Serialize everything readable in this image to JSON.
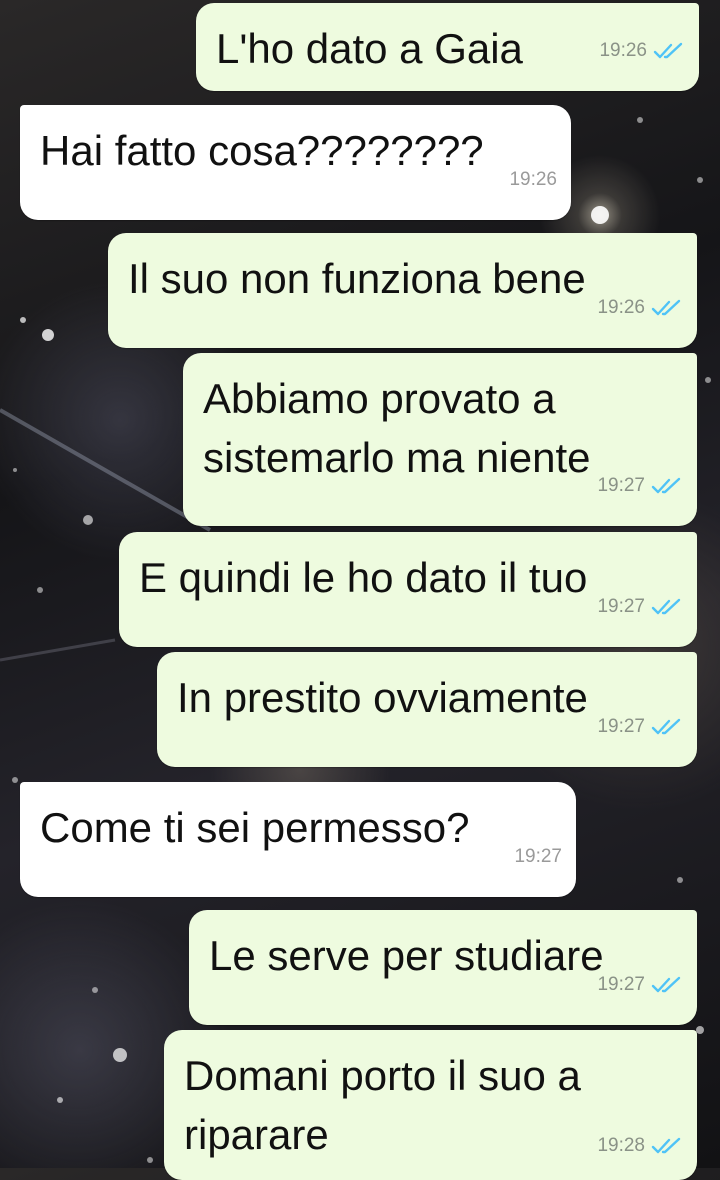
{
  "colors": {
    "outgoing_bubble": "#eefbdf",
    "incoming_bubble": "#ffffff",
    "read_receipt": "#4fc3f7",
    "timestamp": "#8a9287"
  },
  "messages": [
    {
      "id": "m1",
      "direction": "outgoing",
      "lines": [
        "L'ho dato a Gaia"
      ],
      "time": "19:26",
      "status_icon": "double-check-read-icon"
    },
    {
      "id": "m2",
      "direction": "incoming",
      "lines": [
        "Hai fatto cosa????????"
      ],
      "time": "19:26"
    },
    {
      "id": "m3",
      "direction": "outgoing",
      "lines": [
        "Il suo non funziona bene"
      ],
      "time": "19:26",
      "status_icon": "double-check-read-icon"
    },
    {
      "id": "m4",
      "direction": "outgoing",
      "lines": [
        "Abbiamo provato a",
        "sistemarlo ma niente"
      ],
      "time": "19:27",
      "status_icon": "double-check-read-icon"
    },
    {
      "id": "m5",
      "direction": "outgoing",
      "lines": [
        "E quindi le ho dato il tuo"
      ],
      "time": "19:27",
      "status_icon": "double-check-read-icon"
    },
    {
      "id": "m6",
      "direction": "outgoing",
      "lines": [
        "In prestito ovviamente"
      ],
      "time": "19:27",
      "status_icon": "double-check-read-icon"
    },
    {
      "id": "m7",
      "direction": "incoming",
      "lines": [
        "Come ti sei permesso?"
      ],
      "time": "19:27"
    },
    {
      "id": "m8",
      "direction": "outgoing",
      "lines": [
        "Le serve per studiare"
      ],
      "time": "19:27",
      "status_icon": "double-check-read-icon"
    },
    {
      "id": "m9",
      "direction": "outgoing",
      "lines": [
        "Domani porto il suo a",
        "riparare"
      ],
      "time": "19:28",
      "status_icon": "double-check-read-icon"
    }
  ]
}
